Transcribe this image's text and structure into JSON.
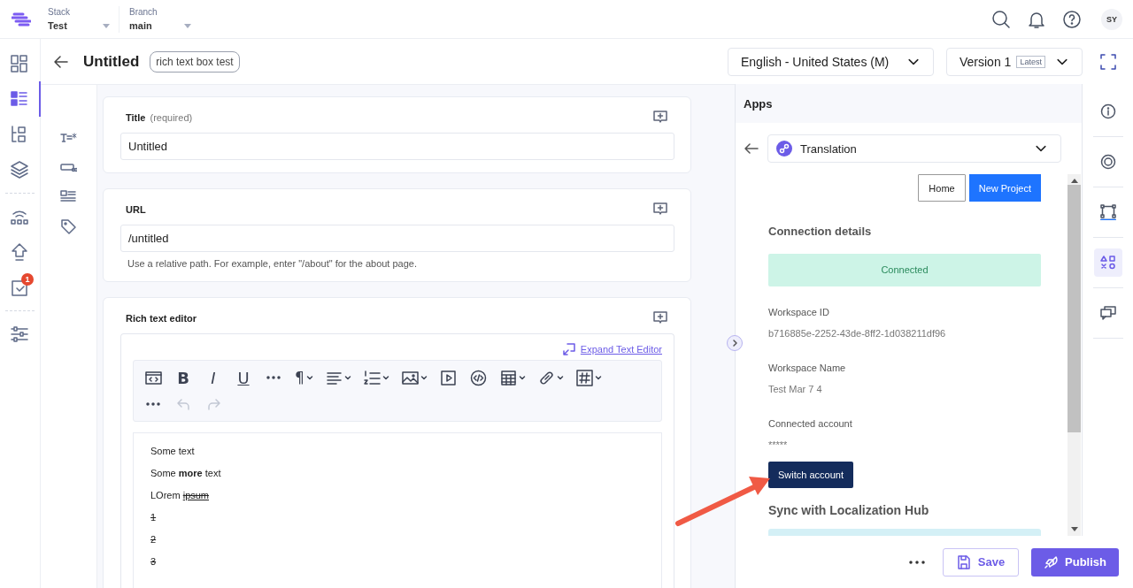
{
  "topbar": {
    "switchers": [
      {
        "label": "Stack",
        "value": "Test"
      },
      {
        "label": "Branch",
        "value": "main"
      }
    ],
    "avatar": "SY"
  },
  "nav": [
    {
      "kind": "dashboard",
      "selected": false
    },
    {
      "kind": "entries",
      "selected": true
    },
    {
      "kind": "models",
      "selected": false
    },
    {
      "kind": "layers",
      "selected": false
    },
    {
      "kind": "divider"
    },
    {
      "kind": "network",
      "selected": false
    },
    {
      "kind": "deploy",
      "selected": false
    },
    {
      "kind": "tasks",
      "selected": false,
      "badge": "1"
    },
    {
      "kind": "divider"
    },
    {
      "kind": "settings",
      "selected": false
    }
  ],
  "entry": {
    "title": "Untitled",
    "tag": "rich text box test",
    "locale": "English - United States (M)",
    "version": "Version 1",
    "version_badge": "Latest"
  },
  "field_rail": [
    {
      "kind": "text"
    },
    {
      "kind": "link"
    },
    {
      "kind": "rte"
    },
    {
      "kind": "tag"
    }
  ],
  "fields": [
    {
      "kind": "input",
      "label": "Title",
      "note": "(required)",
      "value": "Untitled"
    },
    {
      "kind": "input",
      "label": "URL",
      "value": "/untitled",
      "help": "Use a relative path. For example, enter \"/about\" for the about page."
    },
    {
      "kind": "rte",
      "label": "Rich text editor",
      "expand": "Expand Text Editor",
      "toolbar_rows": [
        [
          {
            "kind": "source",
            "dropdown": false,
            "disabled": false
          },
          {
            "kind": "bold",
            "glyph": "B",
            "dropdown": false,
            "disabled": false
          },
          {
            "kind": "italic",
            "glyph": "I",
            "dropdown": false,
            "disabled": false
          },
          {
            "kind": "underline",
            "glyph": "U",
            "dropdown": false,
            "disabled": false
          },
          {
            "kind": "more",
            "dropdown": false,
            "disabled": false
          },
          {
            "kind": "paragraph",
            "glyph": "¶",
            "dropdown": true,
            "disabled": false
          },
          {
            "kind": "align",
            "dropdown": true,
            "disabled": false
          },
          {
            "kind": "list",
            "dropdown": true,
            "disabled": false
          },
          {
            "kind": "image",
            "dropdown": true,
            "disabled": false
          },
          {
            "kind": "video",
            "dropdown": false,
            "disabled": false
          },
          {
            "kind": "embed",
            "dropdown": false,
            "disabled": false
          },
          {
            "kind": "table",
            "dropdown": true,
            "disabled": false
          },
          {
            "kind": "link",
            "dropdown": true,
            "disabled": false
          },
          {
            "kind": "hash",
            "dropdown": true,
            "disabled": false
          }
        ],
        [
          {
            "kind": "more",
            "dropdown": false,
            "disabled": false
          },
          {
            "kind": "undo",
            "dropdown": false,
            "disabled": true
          },
          {
            "kind": "redo",
            "dropdown": false,
            "disabled": true
          }
        ]
      ],
      "content": [
        [
          {
            "text": "Some text",
            "bold": false,
            "strike": false,
            "underline": false
          }
        ],
        [
          {
            "text": "Some ",
            "bold": false,
            "strike": false,
            "underline": false
          },
          {
            "text": "more",
            "bold": true,
            "strike": false,
            "underline": false
          },
          {
            "text": " text",
            "bold": false,
            "strike": false,
            "underline": false
          }
        ],
        [
          {
            "text": "LOrem ",
            "bold": false,
            "strike": false,
            "underline": false
          },
          {
            "text": "ipsum ",
            "bold": false,
            "strike": true,
            "underline": true
          }
        ],
        [
          {
            "text": "1",
            "bold": false,
            "strike": true,
            "underline": false
          }
        ],
        [
          {
            "text": "2",
            "bold": false,
            "strike": true,
            "underline": false
          }
        ],
        [
          {
            "text": "3",
            "bold": false,
            "strike": true,
            "underline": false
          }
        ]
      ]
    }
  ],
  "apps": {
    "title": "Apps",
    "app": "Translation",
    "buttons": [
      {
        "label": "Home",
        "kind": "outline"
      },
      {
        "label": "New Project",
        "kind": "primary"
      }
    ],
    "section": "Connection details",
    "status": "Connected",
    "details": [
      {
        "label": "Workspace ID",
        "value": "b716885e-2252-43de-8ff2-1d038211df96"
      },
      {
        "label": "Workspace Name",
        "value": "Test Mar 7 4"
      },
      {
        "label": "Connected account",
        "value": "*****"
      }
    ],
    "action": "Switch account",
    "sync_title": "Sync with Localization Hub"
  },
  "right_rail": [
    {
      "kind": "info",
      "selected": false
    },
    {
      "kind": "target",
      "selected": false
    },
    {
      "kind": "workflow",
      "selected": false
    },
    {
      "kind": "shapes",
      "selected": true
    },
    {
      "kind": "comments",
      "selected": false
    }
  ],
  "footer": {
    "save": "Save",
    "publish": "Publish"
  }
}
